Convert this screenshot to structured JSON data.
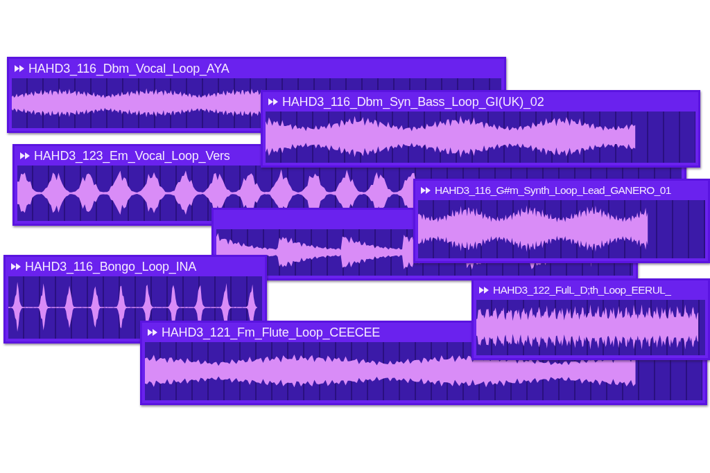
{
  "clips": [
    {
      "title": "HAHD3_116_Dbm_Vocal_Loop_AYA"
    },
    {
      "title": "HAHD3_123_Em_Vocal_Loop_Vers"
    },
    {
      "title": "HAHD3_116_Dbm_Syn_Bass_Loop_GI(UK)_02"
    },
    {
      "title": "HAHD3_116_G#m_Synth_Loop_Lead_GANERO_01"
    },
    {
      "title": "HAHD3_116_Bongo_Loop_INA"
    },
    {
      "title": "HAHD3_121_Fm_Flute_Loop_CEECEE"
    },
    {
      "title": "HAHD3_122_FulL_D;th_Loop_EERUL_"
    }
  ]
}
